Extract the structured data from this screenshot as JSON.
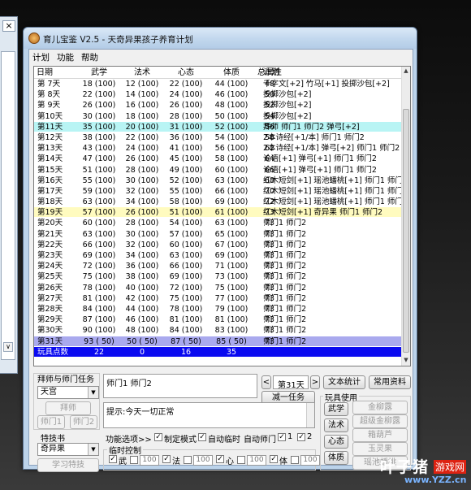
{
  "left_window": {
    "close_glyph": "×",
    "scroll_glyph": "∨"
  },
  "window": {
    "title": "育儿宝鉴 V2.5 - 天奇异果孩子养育计划"
  },
  "menu": [
    "计划",
    "功能",
    "帮助"
  ],
  "table": {
    "columns": [
      "日期",
      "武学",
      "法术",
      "心态",
      "体质",
      "总属性",
      "计划"
    ],
    "rows": [
      {
        "day": "第 7天",
        "wx": "18 (100)",
        "fs": "12 (100)",
        "xt": "22 (100)",
        "tz": "44 (100)",
        "total": "48",
        "plan": "千字文[+2] 竹马[+1] 投掷沙包[+2]",
        "style": ""
      },
      {
        "day": "第 8天",
        "wx": "22 (100)",
        "fs": "14 (100)",
        "xt": "24 (100)",
        "tz": "46 (100)",
        "total": "50",
        "plan": "投掷沙包[+2]",
        "style": ""
      },
      {
        "day": "第 9天",
        "wx": "26 (100)",
        "fs": "16 (100)",
        "xt": "26 (100)",
        "tz": "48 (100)",
        "total": "52",
        "plan": "投掷沙包[+2]",
        "style": ""
      },
      {
        "day": "第10天",
        "wx": "30 (100)",
        "fs": "18 (100)",
        "xt": "28 (100)",
        "tz": "50 (100)",
        "total": "54",
        "plan": "投掷沙包[+2]",
        "style": ""
      },
      {
        "day": "第11天",
        "wx": "35 (100)",
        "fs": "20 (100)",
        "xt": "31 (100)",
        "tz": "52 (100)",
        "total": "56",
        "plan": "拜师 师门1 师门2 弹弓[+2]",
        "style": "cyan"
      },
      {
        "day": "第12天",
        "wx": "38 (100)",
        "fs": "22 (100)",
        "xt": "36 (100)",
        "tz": "54 (100)",
        "total": "58",
        "plan": "2本诗经[+1/本] 师门1 师门2",
        "style": ""
      },
      {
        "day": "第13天",
        "wx": "43 (100)",
        "fs": "24 (100)",
        "xt": "41 (100)",
        "tz": "56 (100)",
        "total": "62",
        "plan": "2本诗经[+1/本] 弹弓[+2] 师门1 师门2",
        "style": ""
      },
      {
        "day": "第14天",
        "wx": "47 (100)",
        "fs": "26 (100)",
        "xt": "45 (100)",
        "tz": "58 (100)",
        "total": "64",
        "plan": "论语[+1] 弹弓[+1] 师门1 师门2",
        "style": ""
      },
      {
        "day": "第15天",
        "wx": "51 (100)",
        "fs": "28 (100)",
        "xt": "49 (100)",
        "tz": "60 (100)",
        "total": "66",
        "plan": "论语[+1] 弹弓[+1] 师门1 师门2",
        "style": ""
      },
      {
        "day": "第16天",
        "wx": "55 (100)",
        "fs": "30 (100)",
        "xt": "52 (100)",
        "tz": "63 (100)",
        "total": "68",
        "plan": "红木短剑[+1] 瑶池蟠桃[+1] 师门1 师门2",
        "style": ""
      },
      {
        "day": "第17天",
        "wx": "59 (100)",
        "fs": "32 (100)",
        "xt": "55 (100)",
        "tz": "66 (100)",
        "total": "70",
        "plan": "红木短剑[+1] 瑶池蟠桃[+1] 师门1 师门2",
        "style": ""
      },
      {
        "day": "第18天",
        "wx": "63 (100)",
        "fs": "34 (100)",
        "xt": "58 (100)",
        "tz": "69 (100)",
        "total": "72",
        "plan": "红木短剑[+1] 瑶池蟠桃[+1] 师门1 师门2",
        "style": ""
      },
      {
        "day": "第19天",
        "wx": "57 (100)",
        "fs": "26 (100)",
        "xt": "51 (100)",
        "tz": "61 (100)",
        "total": "73",
        "plan": "红木短剑[+1] 奇异果 师门1 师门2",
        "style": "yellow"
      },
      {
        "day": "第20天",
        "wx": "60 (100)",
        "fs": "28 (100)",
        "xt": "54 (100)",
        "tz": "63 (100)",
        "total": "73",
        "plan": "师门1 师门2",
        "style": ""
      },
      {
        "day": "第21天",
        "wx": "63 (100)",
        "fs": "30 (100)",
        "xt": "57 (100)",
        "tz": "65 (100)",
        "total": "73",
        "plan": "师门1 师门2",
        "style": ""
      },
      {
        "day": "第22天",
        "wx": "66 (100)",
        "fs": "32 (100)",
        "xt": "60 (100)",
        "tz": "67 (100)",
        "total": "73",
        "plan": "师门1 师门2",
        "style": ""
      },
      {
        "day": "第23天",
        "wx": "69 (100)",
        "fs": "34 (100)",
        "xt": "63 (100)",
        "tz": "69 (100)",
        "total": "73",
        "plan": "师门1 师门2",
        "style": ""
      },
      {
        "day": "第24天",
        "wx": "72 (100)",
        "fs": "36 (100)",
        "xt": "66 (100)",
        "tz": "71 (100)",
        "total": "73",
        "plan": "师门1 师门2",
        "style": ""
      },
      {
        "day": "第25天",
        "wx": "75 (100)",
        "fs": "38 (100)",
        "xt": "69 (100)",
        "tz": "73 (100)",
        "total": "73",
        "plan": "师门1 师门2",
        "style": ""
      },
      {
        "day": "第26天",
        "wx": "78 (100)",
        "fs": "40 (100)",
        "xt": "72 (100)",
        "tz": "75 (100)",
        "total": "73",
        "plan": "师门1 师门2",
        "style": ""
      },
      {
        "day": "第27天",
        "wx": "81 (100)",
        "fs": "42 (100)",
        "xt": "75 (100)",
        "tz": "77 (100)",
        "total": "73",
        "plan": "师门1 师门2",
        "style": ""
      },
      {
        "day": "第28天",
        "wx": "84 (100)",
        "fs": "44 (100)",
        "xt": "78 (100)",
        "tz": "79 (100)",
        "total": "73",
        "plan": "师门1 师门2",
        "style": ""
      },
      {
        "day": "第29天",
        "wx": "87 (100)",
        "fs": "46 (100)",
        "xt": "81 (100)",
        "tz": "81 (100)",
        "total": "73",
        "plan": "师门1 师门2",
        "style": ""
      },
      {
        "day": "第30天",
        "wx": "90 (100)",
        "fs": "48 (100)",
        "xt": "84 (100)",
        "tz": "83 (100)",
        "total": "73",
        "plan": "师门1 师门2",
        "style": ""
      },
      {
        "day": "第31天",
        "wx": "93 ( 50)",
        "fs": "50 ( 50)",
        "xt": "87 ( 50)",
        "tz": "85 ( 50)",
        "total": "73",
        "plan": "师门1 师门2",
        "style": "sel"
      },
      {
        "day": "玩具点数",
        "wx": "22",
        "fs": "0",
        "xt": "16",
        "tz": "35",
        "total": "",
        "plan": "",
        "style": "sum"
      }
    ]
  },
  "panel": {
    "master_group_label": "拜师与师门任务",
    "master_combo": "天宫",
    "btn_bai_shi": "拜师",
    "btn_shimen1": "师门1",
    "btn_shimen2": "师门2",
    "skillbook_label": "特技书",
    "skillbook_combo": "奇异果",
    "btn_learn_skill": "学习特技",
    "plan_text": "师门1 师门2",
    "day_prev": "<",
    "day_value": "第31天",
    "day_next": ">",
    "btn_reduce_task": "减一任务",
    "hint_text": "提示:今天一切正常",
    "btn_text_stats": "文本统计",
    "btn_common_data": "常用资料",
    "toys_label": "玩具使用",
    "func_options_label": "功能选项>>",
    "opt_custom_mode": "制定模式",
    "opt_auto_temp": "自动临时",
    "opt_auto_shimen": "自动师门",
    "opt_shimen1": "1",
    "opt_shimen2": "2",
    "temp_control_label": "临时控制",
    "temp_items": [
      {
        "label": "武",
        "value": "100"
      },
      {
        "label": "法",
        "value": "100"
      },
      {
        "label": "心",
        "value": "100"
      },
      {
        "label": "体",
        "value": "100"
      }
    ],
    "attr_buttons": [
      "武学",
      "法术",
      "心态",
      "体质"
    ],
    "toy_buttons": [
      "金柳露",
      "超级金柳露",
      "箱葫芦",
      "玉灵果",
      "瑶池蟠桃"
    ]
  },
  "watermark": {
    "name1": "叶子猪",
    "name2": "游戏网",
    "url": "www.YZZ.cn"
  }
}
